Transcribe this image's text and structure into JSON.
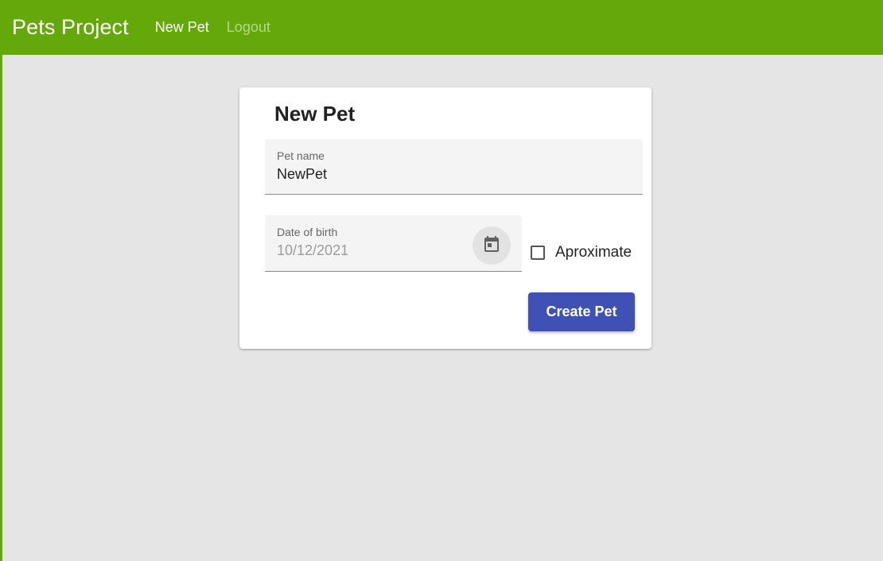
{
  "header": {
    "app_title": "Pets Project",
    "nav": [
      {
        "label": "New Pet"
      },
      {
        "label": "Logout"
      }
    ]
  },
  "form": {
    "title": "New Pet",
    "pet_name": {
      "label": "Pet name",
      "value": "NewPet"
    },
    "date_of_birth": {
      "label": "Date of birth",
      "value": "10/12/2021",
      "icon": "calendar-icon"
    },
    "approximate": {
      "label": "Aproximate",
      "checked": false
    },
    "submit_label": "Create Pet"
  },
  "colors": {
    "toolbar": "#64a80a",
    "primary_button": "#3f51b5",
    "background": "#e5e5e5"
  }
}
